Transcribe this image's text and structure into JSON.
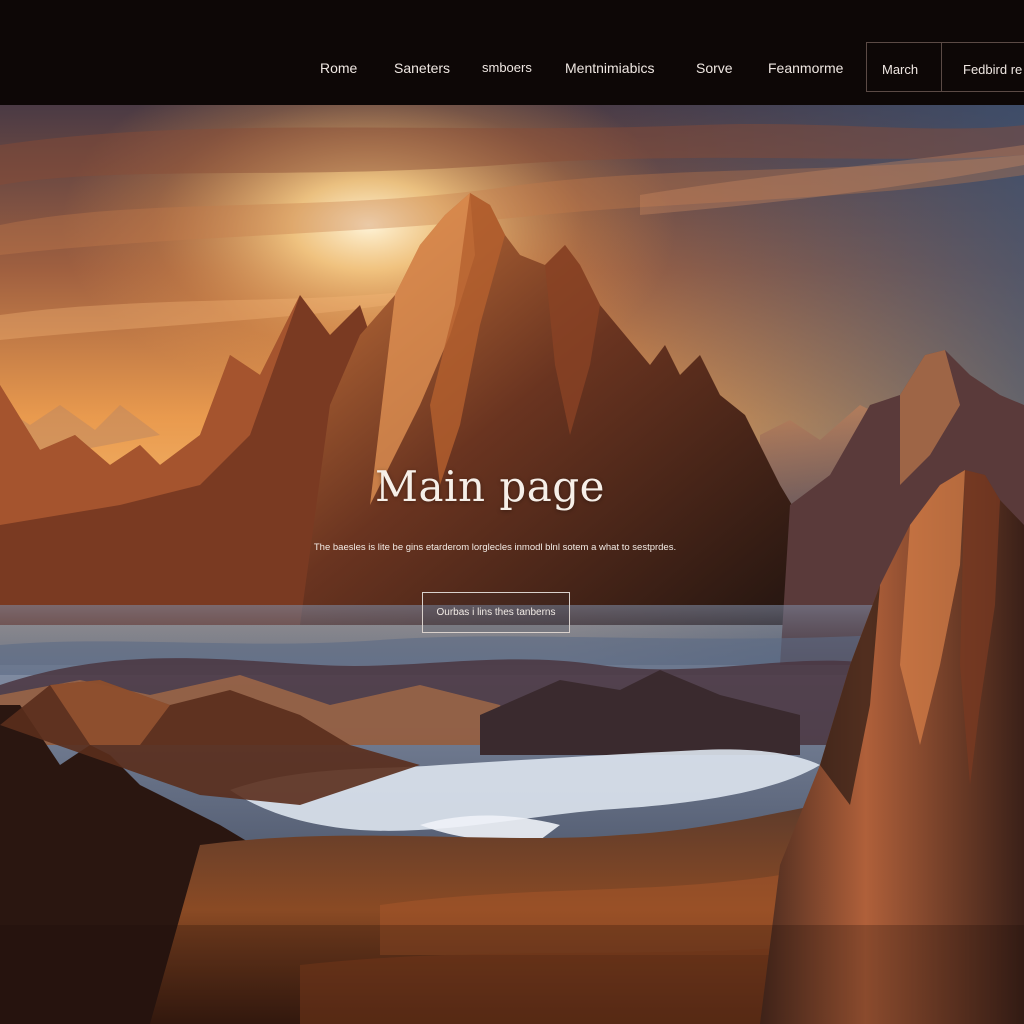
{
  "nav": {
    "links": [
      {
        "label": "Rome",
        "name": "nav-link-rome"
      },
      {
        "label": "Saneters",
        "name": "nav-link-saneters"
      },
      {
        "label": "smboers",
        "name": "nav-link-smboers"
      },
      {
        "label": "Mentnimiabics",
        "name": "nav-link-mentnimiabics"
      },
      {
        "label": "Sorve",
        "name": "nav-link-sorve"
      },
      {
        "label": "Feanmorme",
        "name": "nav-link-feanmorme"
      }
    ],
    "boxed": [
      {
        "label": "March",
        "name": "nav-button-march"
      },
      {
        "label": "Fedbird re",
        "name": "nav-button-fedbird"
      }
    ]
  },
  "hero": {
    "title": "Main page",
    "subtitle": "The baesles is lite be gins etarderom lorglecles inmodl blnl sotem a what to sestprdes.",
    "cta_label": "Ourbas i lins thes tanberns"
  },
  "colors": {
    "topbar_bg": "#0d0706",
    "nav_text": "#efe7e2",
    "sky_warm": "#f2a04d",
    "sky_cool": "#405a78",
    "mountain_dark": "#2a1610"
  }
}
